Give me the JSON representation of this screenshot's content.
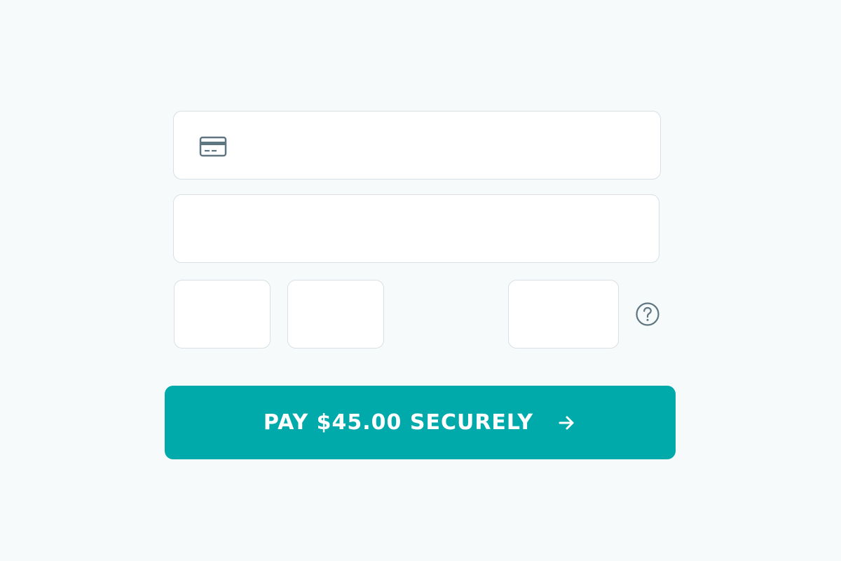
{
  "form": {
    "card_number": {
      "value": "",
      "placeholder": "",
      "icon": "credit-card-icon"
    },
    "cardholder_name": {
      "value": "",
      "placeholder": ""
    },
    "exp_month": {
      "value": "",
      "placeholder": ""
    },
    "exp_year": {
      "value": "",
      "placeholder": ""
    },
    "cvc": {
      "value": "",
      "placeholder": ""
    },
    "cvc_help_icon": "question-circle-icon"
  },
  "pay_button": {
    "label": "PAY $45.00 SECURELY",
    "icon": "arrow-right-icon"
  },
  "colors": {
    "page_background": "#f6fafb",
    "field_border": "#d8e0e6",
    "accent": "#00aaaa",
    "icon": "#5f7680"
  }
}
